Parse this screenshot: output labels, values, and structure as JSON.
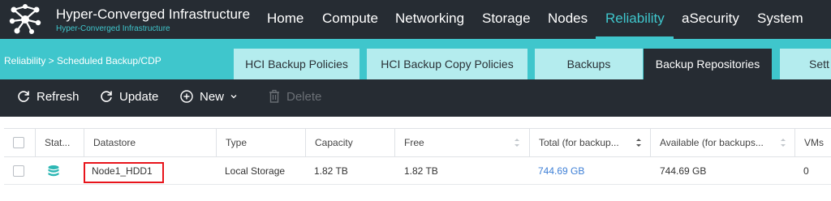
{
  "header": {
    "title": "Hyper-Converged Infrastructure",
    "subtitle": "Hyper-Converged Infrastructure",
    "logo_icon": "network-nodes-logo",
    "nav": [
      "Home",
      "Compute",
      "Networking",
      "Storage",
      "Nodes",
      "Reliability",
      "aSecurity",
      "System"
    ],
    "active_nav": "Reliability"
  },
  "breadcrumb": "Reliability  > Scheduled Backup/CDP",
  "tabs": [
    "HCI Backup Policies",
    "HCI Backup Copy Policies",
    "Backups",
    "Backup Repositories",
    "Sett"
  ],
  "active_tab": "Backup Repositories",
  "toolbar": {
    "refresh": "Refresh",
    "update": "Update",
    "new": "New",
    "delete": "Delete"
  },
  "table": {
    "columns": [
      "Stat...",
      "Datastore",
      "Type",
      "Capacity",
      "Free",
      "Total (for backup...",
      "Available (for backups...",
      "VMs"
    ],
    "rows": [
      {
        "status_icon": "database-icon",
        "datastore": "Node1_HDD1",
        "type": "Local Storage",
        "capacity": "1.82 TB",
        "free": "1.82 TB",
        "total": "744.69 GB",
        "available": "744.69 GB",
        "vms": "0"
      }
    ]
  },
  "colors": {
    "topbar": "#262c33",
    "accent": "#3fc6cc",
    "tab_inactive": "#b4ecee",
    "link": "#3d7fd6",
    "highlight": "#e8141b"
  }
}
